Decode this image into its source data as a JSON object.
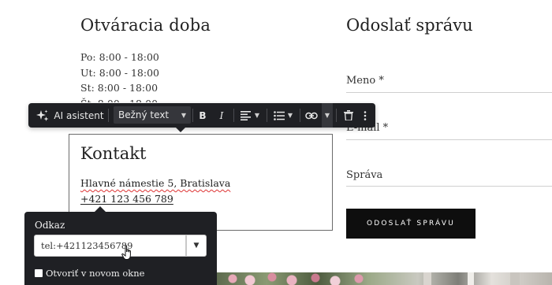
{
  "hours": {
    "heading": "Otváracia doba",
    "lines": [
      "Po: 8:00 - 18:00",
      "Ut: 8:00 - 18:00",
      "St: 8:00 - 18:00",
      "Št: 8:00 - 18:00"
    ]
  },
  "contact": {
    "heading": "Kontakt",
    "address": "Hlavné námestie 5, Bratislava",
    "phone": "+421 123 456 789"
  },
  "message": {
    "heading": "Odoslať správu",
    "fields": [
      "Meno *",
      "E-mail *",
      "Správa"
    ],
    "submit_label": "ODOSLAŤ SPRÁVU"
  },
  "toolbar": {
    "ai_label": "AI asistent",
    "style_label": "Bežný text",
    "bold_label": "B",
    "italic_label": "I"
  },
  "link_popover": {
    "title": "Odkaz",
    "value": "tel:+421123456789",
    "new_window_label": "Otvoriť v novom okne",
    "new_window_checked": false
  },
  "colors": {
    "toolbar_bg": "#1f2024",
    "button_bg": "#0e0e0e"
  }
}
